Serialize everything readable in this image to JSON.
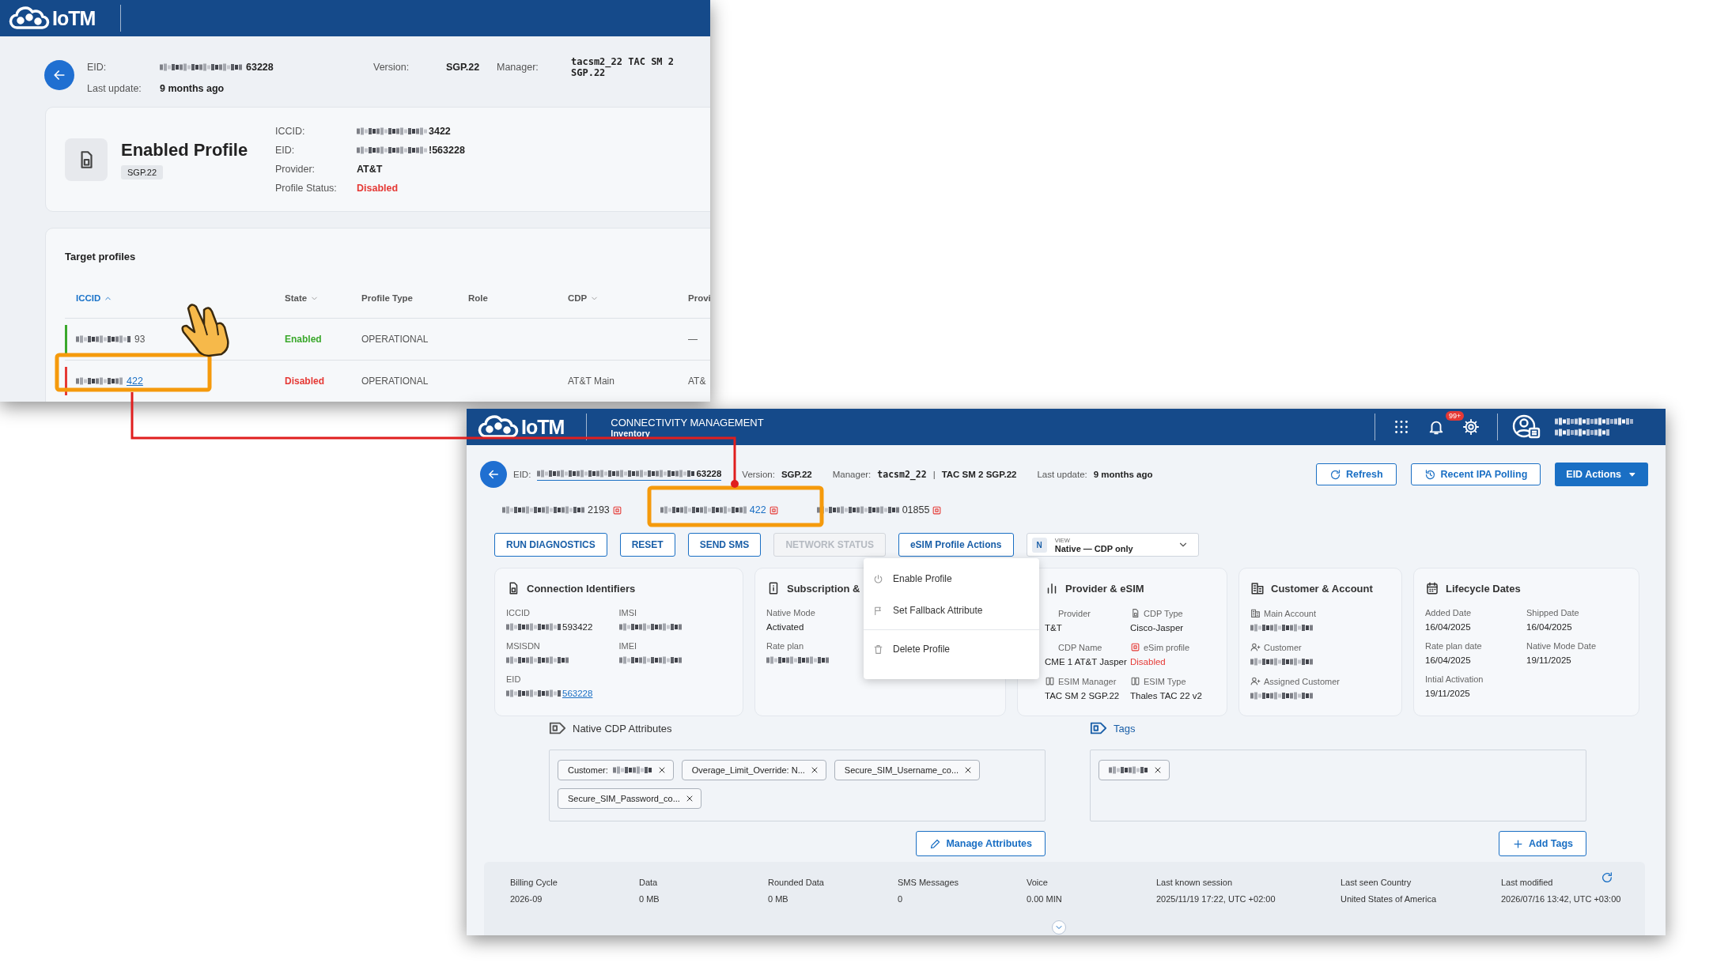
{
  "back_window": {
    "header": {
      "brand": "IoTM"
    },
    "eid_bar": {
      "eid": {
        "label": "EID:",
        "value": "63228",
        "redacted": true
      },
      "last_update": {
        "label": "Last update:",
        "value": "9 months ago"
      },
      "version": {
        "label": "Version:",
        "value": "SGP.22"
      },
      "manager": {
        "label": "Manager:",
        "value": "tacsm2_22 TAC SM 2 SGP.22"
      }
    },
    "enabled_profile": {
      "title": "Enabled Profile",
      "badge": "SGP.22",
      "fields": [
        {
          "label": "ICCID:",
          "value": "3422",
          "redacted": true
        },
        {
          "label": "EID:",
          "value": "!563228",
          "redacted": true
        },
        {
          "label": "Provider:",
          "value": "AT&T"
        },
        {
          "label": "Profile Status:",
          "value": "Disabled",
          "color": "#e53935"
        }
      ]
    },
    "target_profiles": {
      "title": "Target profiles",
      "columns": [
        {
          "label": "ICCID",
          "sortable": true,
          "selected": true
        },
        {
          "label": "State",
          "sortable": true,
          "selected": false
        },
        {
          "label": "Profile Type",
          "sortable": false,
          "selected": false
        },
        {
          "label": "Role",
          "sortable": false,
          "selected": false
        },
        {
          "label": "CDP",
          "sortable": true,
          "selected": false
        },
        {
          "label": "Provi",
          "sortable": false,
          "selected": false
        }
      ],
      "rows": [
        {
          "iccid": {
            "value": "93",
            "redacted": true,
            "link": false
          },
          "state": "Enabled",
          "color": "#3aa82b",
          "profile_type": "OPERATIONAL",
          "provider": "—"
        },
        {
          "iccid": {
            "value": "422",
            "redacted": true,
            "link": true
          },
          "state": "Disabled",
          "color": "#e53935",
          "profile_type": "OPERATIONAL",
          "cdp": "AT&T Main",
          "provider": "AT&"
        }
      ]
    }
  },
  "front_window": {
    "header": {
      "brand": "IoTM",
      "section": "CONNECTIVITY MANAGEMENT",
      "page": "Inventory",
      "notifications": "99+"
    },
    "eid_bar": {
      "eid": {
        "label": "EID:",
        "value": "63228",
        "redacted": true
      },
      "version": {
        "label": "Version:",
        "value": "SGP.22"
      },
      "manager": {
        "label": "Manager:",
        "value": "tacsm2_22"
      },
      "separator": "|",
      "manager_detail": "TAC SM 2 SGP.22",
      "last_update": {
        "label": "Last update:",
        "value": "9 months ago"
      }
    },
    "eid_actions": [
      {
        "label": "Refresh",
        "kind": "outline"
      },
      {
        "label": "Recent IPA Polling",
        "kind": "outline"
      },
      {
        "label": "EID Actions",
        "kind": "dropdown"
      }
    ],
    "profile_tabs": [
      {
        "value": "2193",
        "redacted": true,
        "selected": false
      },
      {
        "value": "422",
        "redacted": true,
        "selected": true
      },
      {
        "value": "01855",
        "redacted": true,
        "selected": false
      }
    ],
    "profile_actions": [
      {
        "label": "RUN DIAGNOSTICS",
        "disabled": false
      },
      {
        "label": "RESET",
        "disabled": false
      },
      {
        "label": "SEND SMS",
        "disabled": false
      },
      {
        "label": "NETWORK STATUS",
        "disabled": true
      },
      {
        "label": "eSIM Profile Actions",
        "disabled": false
      }
    ],
    "view_select": {
      "badge": "N",
      "label": "VIEW",
      "value": "Native — CDP only"
    },
    "profile_actions_menu": [
      {
        "label": "Enable Profile"
      },
      {
        "label": "Set Fallback Attribute"
      },
      {
        "label": "Delete Profile"
      }
    ],
    "cards": [
      {
        "title": "Connection Identifiers",
        "fields": [
          {
            "label": "ICCID",
            "value": "593422",
            "redacted": true
          },
          {
            "label": "IMSI",
            "redacted": true
          },
          {
            "label": "MSISDN",
            "redacted": true
          },
          {
            "label": "IMEI",
            "redacted": true
          },
          {
            "label": "EID",
            "value": "563228",
            "redacted": true,
            "link": true
          }
        ]
      },
      {
        "title": "Subscription &",
        "fields": [
          {
            "label": "Native Mode",
            "value": "Activated"
          },
          {
            "label": "Rate plan",
            "redacted": true
          }
        ]
      },
      {
        "title": "Provider & eSIM",
        "fields": [
          {
            "label": "Provider",
            "value": "T&T"
          },
          {
            "label": "CDP Type",
            "value": "Cisco-Jasper"
          },
          {
            "label": "CDP Name",
            "value": "CME 1 AT&T Jasper"
          },
          {
            "label": "eSim profile",
            "value": "Disabled",
            "color": "#e53935"
          },
          {
            "label": "ESIM Manager",
            "value": "TAC SM 2 SGP.22"
          },
          {
            "label": "ESIM Type",
            "value": "Thales TAC 22 v2"
          }
        ]
      },
      {
        "title": "Customer & Account",
        "fields": [
          {
            "label": "Main Account",
            "redacted": true
          },
          {
            "label": "Customer",
            "redacted": true
          },
          {
            "label": "Assigned Customer",
            "redacted": true
          }
        ]
      },
      {
        "title": "Lifecycle Dates",
        "fields": [
          {
            "label": "Added Date",
            "value": "16/04/2025"
          },
          {
            "label": "Shipped Date",
            "value": "16/04/2025"
          },
          {
            "label": "Rate plan date",
            "value": "16/04/2025"
          },
          {
            "label": "Native Mode Date",
            "value": "19/11/2025"
          },
          {
            "label": "Intial Activation",
            "value": "19/11/2025"
          }
        ]
      }
    ],
    "native_cdp_attributes": {
      "title": "Native CDP Attributes",
      "chips": [
        {
          "label": "Customer:",
          "redacted": true
        },
        {
          "label": "Overage_Limit_Override: N..."
        },
        {
          "label": "Secure_SIM_Username_co..."
        },
        {
          "label": "Secure_SIM_Password_co..."
        }
      ],
      "button": "Manage Attributes"
    },
    "tags": {
      "title": "Tags",
      "chips": [
        {
          "redacted": true
        }
      ],
      "button": "Add Tags"
    },
    "usage": [
      {
        "label": "Billing Cycle",
        "value": "2026-09"
      },
      {
        "label": "Data",
        "value": "0 MB"
      },
      {
        "label": "Rounded Data",
        "value": "0 MB"
      },
      {
        "label": "SMS Messages",
        "value": "0"
      },
      {
        "label": "Voice",
        "value": "0.00 MIN"
      },
      {
        "label": "Last known session",
        "value": "2025/11/19 17:22, UTC +02:00"
      },
      {
        "label": "Last seen Country",
        "value": "United States of America"
      },
      {
        "label": "Last modified",
        "value": "2026/07/16 13:42, UTC +03:00"
      }
    ]
  }
}
